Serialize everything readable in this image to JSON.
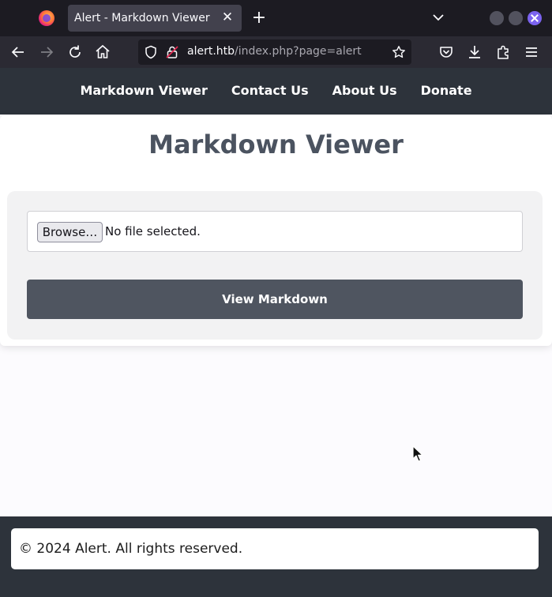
{
  "browser": {
    "tab_title": "Alert - Markdown Viewer",
    "tab_close_icon": "close-icon",
    "new_tab_icon": "plus-icon",
    "url_host": "alert.htb",
    "url_path": "/index.php?page=alert"
  },
  "site": {
    "nav": [
      "Markdown Viewer",
      "Contact Us",
      "About Us",
      "Donate"
    ],
    "heading": "Markdown Viewer",
    "browse_label": "Browse…",
    "file_status": "No file selected.",
    "submit_label": "View Markdown",
    "footer_text": "© 2024 Alert. All rights reserved."
  },
  "colors": {
    "header_bg": "#2d333b",
    "button_bg": "#4f5560",
    "heading": "#4b5360"
  }
}
